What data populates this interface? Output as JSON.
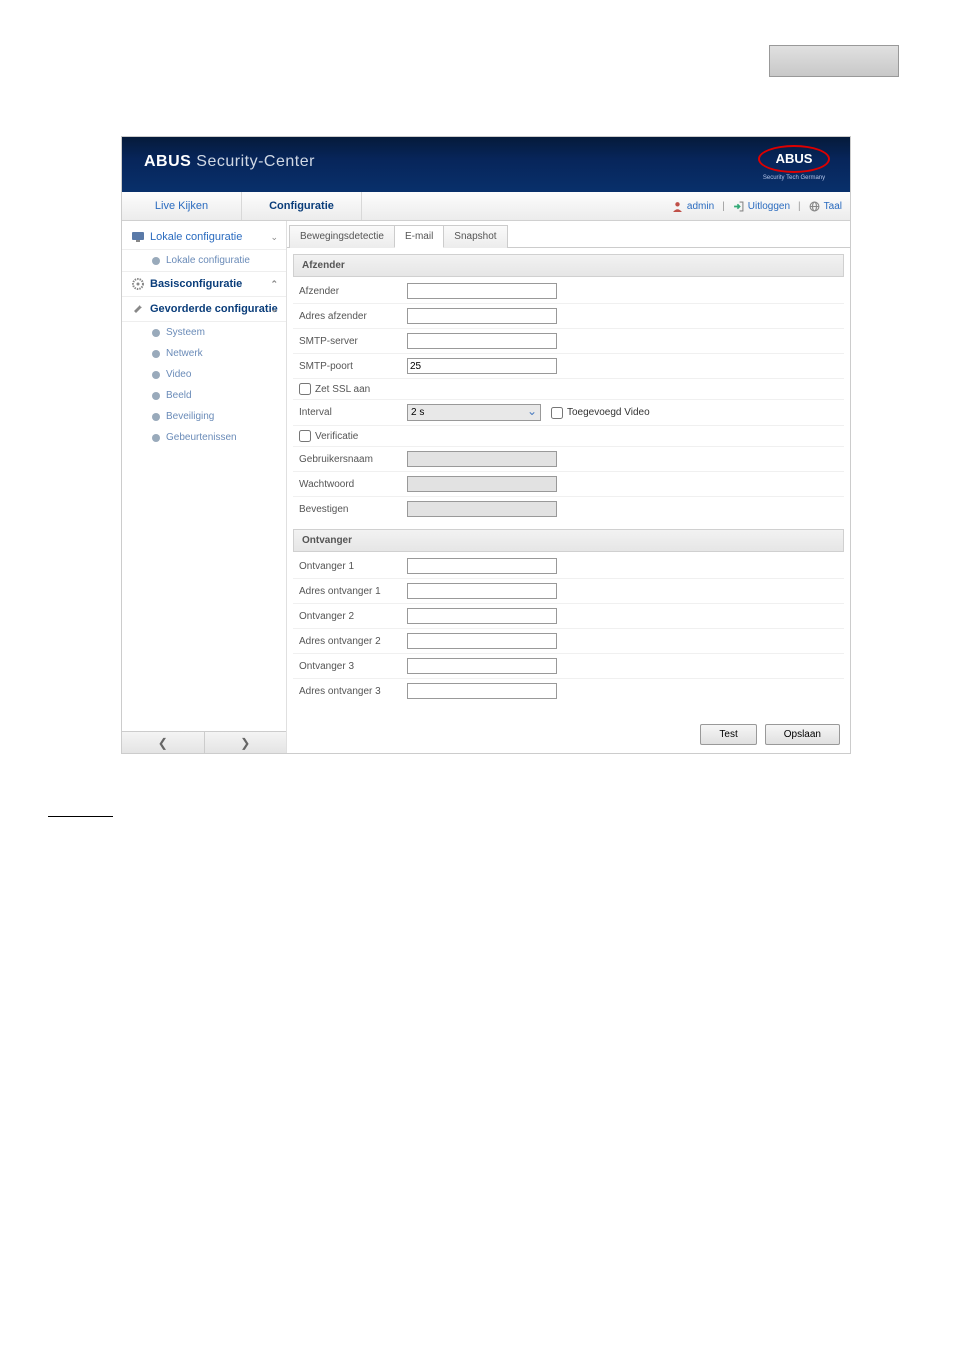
{
  "header": {
    "brand_bold": "ABUS",
    "brand_rest": "Security-Center",
    "logo_text": "ABUS",
    "logo_tag": "Security Tech Germany"
  },
  "menu": {
    "live": "Live Kijken",
    "config": "Configuratie"
  },
  "topright": {
    "user": "admin",
    "logout": "Uitloggen",
    "lang": "Taal"
  },
  "sidebar": {
    "local_config": "Lokale configuratie",
    "local_config_sub": "Lokale configuratie",
    "basic_config": "Basisconfiguratie",
    "adv_config": "Gevorderde configuratie",
    "items": [
      "Systeem",
      "Netwerk",
      "Video",
      "Beeld",
      "Beveiliging",
      "Gebeurtenissen"
    ]
  },
  "tabs": [
    "Bewegingsdetectie",
    "E-mail",
    "Snapshot"
  ],
  "sections": {
    "sender": "Afzender",
    "receiver": "Ontvanger"
  },
  "fields": {
    "sender": "Afzender",
    "sender_address": "Adres afzender",
    "smtp_server": "SMTP-server",
    "smtp_port": "SMTP-poort",
    "ssl": "Zet SSL aan",
    "interval": "Interval",
    "attached_video": "Toegevoegd Video",
    "verify": "Verificatie",
    "username": "Gebruikersnaam",
    "password": "Wachtwoord",
    "confirm": "Bevestigen",
    "recv1": "Ontvanger 1",
    "recv1_addr": "Adres ontvanger 1",
    "recv2": "Ontvanger 2",
    "recv2_addr": "Adres ontvanger 2",
    "recv3": "Ontvanger 3",
    "recv3_addr": "Adres ontvanger 3"
  },
  "values": {
    "smtp_port": "25",
    "interval": "2 s"
  },
  "buttons": {
    "test": "Test",
    "save": "Opslaan"
  }
}
